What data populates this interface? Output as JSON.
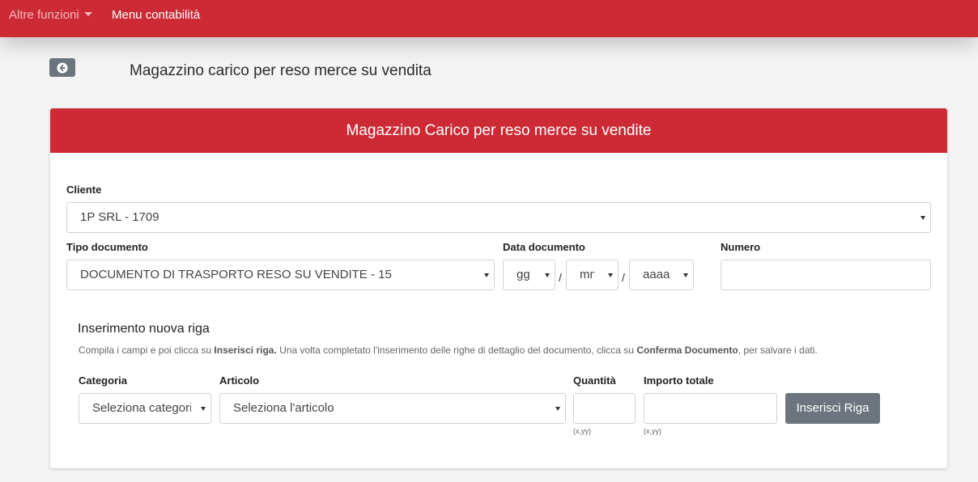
{
  "topnav": {
    "other_functions": "Altre funzioni",
    "accounting_menu": "Menu contabilità"
  },
  "page": {
    "back_icon": "arrow-circle-left-icon",
    "title": "Magazzino carico per reso merce su vendita"
  },
  "card": {
    "header": "Magazzino Carico per reso merce su vendite",
    "cliente": {
      "label": "Cliente",
      "value": "1P              SRL - 1709"
    },
    "tipo_documento": {
      "label": "Tipo documento",
      "value": "DOCUMENTO DI TRASPORTO RESO SU VENDITE - 15"
    },
    "data_documento": {
      "label": "Data documento",
      "day": "gg",
      "month": "mm",
      "year": "aaaa",
      "separator": "/"
    },
    "numero": {
      "label": "Numero",
      "value": ""
    },
    "new_row": {
      "title": "Inserimento nuova riga",
      "help_1": "Compila i campi e poi clicca su ",
      "help_b1": "Inserisci riga.",
      "help_2": " Una volta completato l'inserimento delle righe di dettaglio del documento, clicca su ",
      "help_b2": "Conferma Documento",
      "help_3": ", per salvare i dati.",
      "categoria": {
        "label": "Categoria",
        "value": "Seleziona categoria"
      },
      "articolo": {
        "label": "Articolo",
        "value": "Seleziona l'articolo"
      },
      "quantita": {
        "label": "Quantità",
        "hint": "(x,yy)"
      },
      "importo": {
        "label": "Importo totale",
        "hint": "(x,yy)"
      },
      "insert_button": "Inserisci Riga"
    }
  },
  "colors": {
    "brand_red": "#cc2b36",
    "button_gray": "#6c757d"
  }
}
